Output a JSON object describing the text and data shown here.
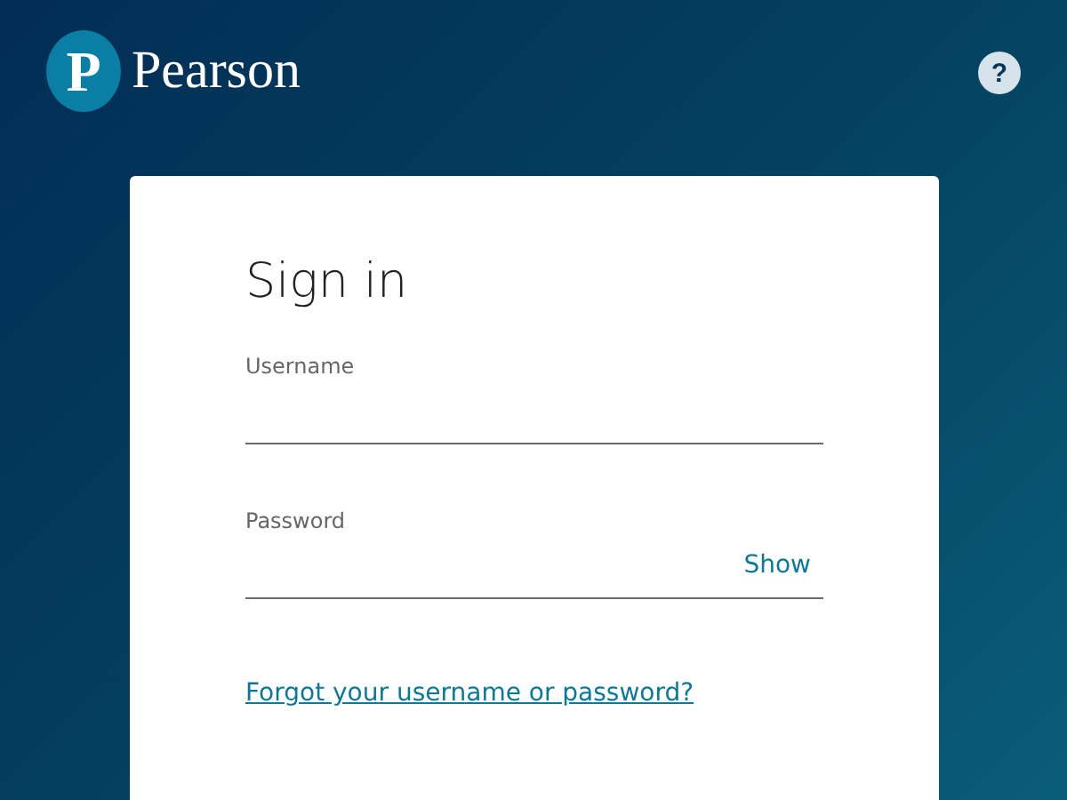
{
  "header": {
    "logo_mark": "P",
    "logo_text": "Pearson",
    "help": "?"
  },
  "form": {
    "title": "Sign in",
    "fields": [
      {
        "label": "Username",
        "kind": "text"
      },
      {
        "label": "Password",
        "kind": "password",
        "toggle": "Show"
      }
    ],
    "link": "Forgot your username or password?"
  }
}
